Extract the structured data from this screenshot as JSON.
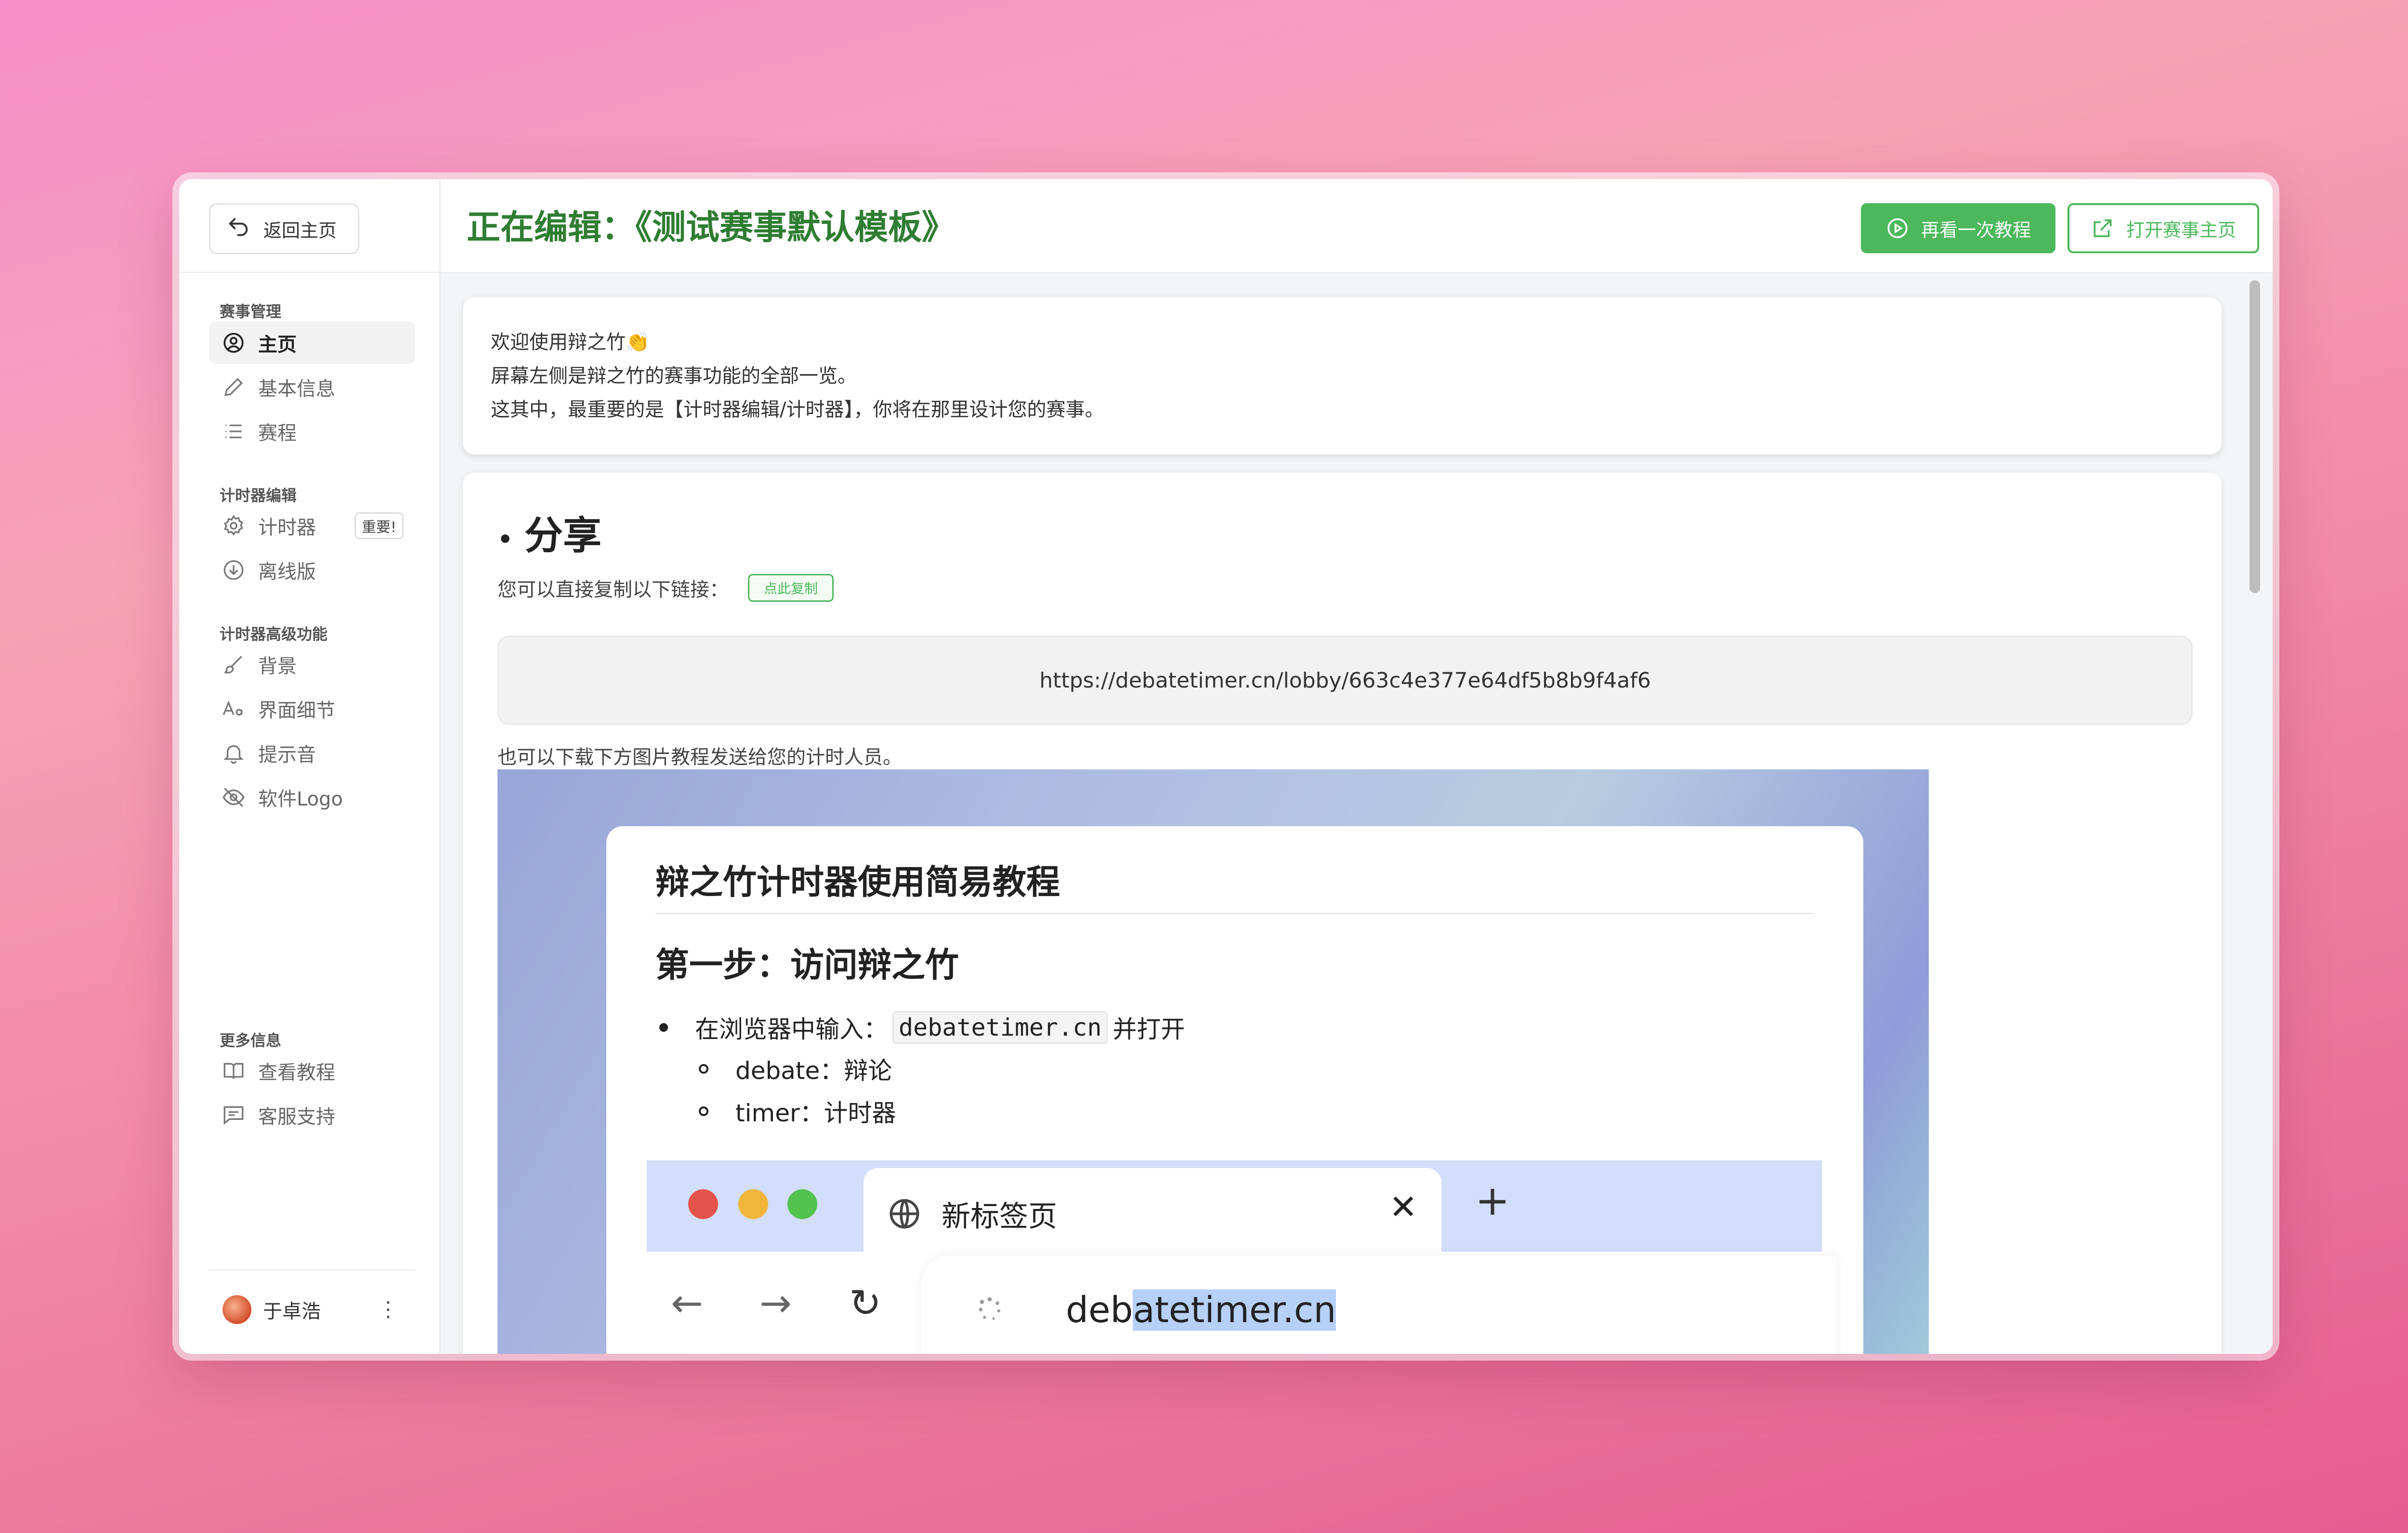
{
  "sidebar": {
    "back_label": "返回主页",
    "sections": [
      {
        "title": "赛事管理"
      },
      {
        "title": "计时器编辑"
      },
      {
        "title": "计时器高级功能"
      },
      {
        "title": "更多信息"
      }
    ],
    "items": [
      {
        "label": "主页",
        "icon": "user-circle-icon",
        "active": true
      },
      {
        "label": "基本信息",
        "icon": "pencil-icon"
      },
      {
        "label": "赛程",
        "icon": "list-icon"
      },
      {
        "label": "计时器",
        "icon": "gear-icon",
        "badge": "重要!"
      },
      {
        "label": "离线版",
        "icon": "download-icon"
      },
      {
        "label": "背景",
        "icon": "brush-icon"
      },
      {
        "label": "界面细节",
        "icon": "font-icon"
      },
      {
        "label": "提示音",
        "icon": "bell-icon"
      },
      {
        "label": "软件Logo",
        "icon": "eye-off-icon"
      },
      {
        "label": "查看教程",
        "icon": "book-icon"
      },
      {
        "label": "客服支持",
        "icon": "chat-icon"
      }
    ],
    "user_name": "于卓浩",
    "more_glyph": "⋮"
  },
  "header": {
    "title": "正在编辑：《测试赛事默认模板》",
    "tutorial_btn": "再看一次教程",
    "open_home_btn": "打开赛事主页"
  },
  "welcome": {
    "line1": "欢迎使用辩之竹👏",
    "line2": "屏幕左侧是辩之竹的赛事功能的全部一览。",
    "line3": "这其中，最重要的是【计时器编辑/计时器】，你将在那里设计您的赛事。"
  },
  "share": {
    "heading": "分享",
    "copy_text": "您可以直接复制以下链接：",
    "copy_btn": "点此复制",
    "url": "https://debatetimer.cn/lobby/663c4e377e64df5b8b9f4af6",
    "download_text": "也可以下载下方图片教程发送给您的计时人员。"
  },
  "tutorial": {
    "title": "辩之竹计时器使用简易教程",
    "step1": "第一步：访问辩之竹",
    "li1_pre": "在浏览器中输入：",
    "li1_code": "debatetimer.cn",
    "li1_post": "并打开",
    "li2": "debate：辩论",
    "li3": "timer：计时器",
    "tab_title": "新标签页",
    "address_pre": "deb",
    "address_sel": "atetimer.cn"
  },
  "colors": {
    "accent": "#4cb85b",
    "title_green": "#2f7d32"
  }
}
